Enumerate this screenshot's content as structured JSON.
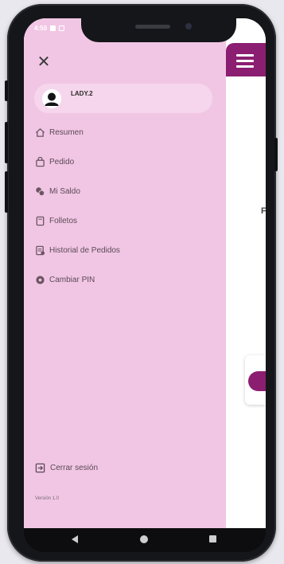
{
  "status_bar": {
    "time": "4:50"
  },
  "user": {
    "name": "LADY.2"
  },
  "menu": [
    {
      "label": "Resumen",
      "icon": "home-icon"
    },
    {
      "label": "Pedido",
      "icon": "shopping-bag-icon"
    },
    {
      "label": "Mi Saldo",
      "icon": "money-icon"
    },
    {
      "label": "Folletos",
      "icon": "brochure-icon"
    },
    {
      "label": "Historial de Pedidos",
      "icon": "history-icon"
    },
    {
      "label": "Cambiar PIN",
      "icon": "pin-icon"
    }
  ],
  "logout": {
    "label": "Cerrar sesión",
    "icon": "logout-icon"
  },
  "version": "Versión 1.0",
  "peek_text": "F",
  "colors": {
    "drawer": "#f1c6e4",
    "accent": "#8b1e70"
  }
}
